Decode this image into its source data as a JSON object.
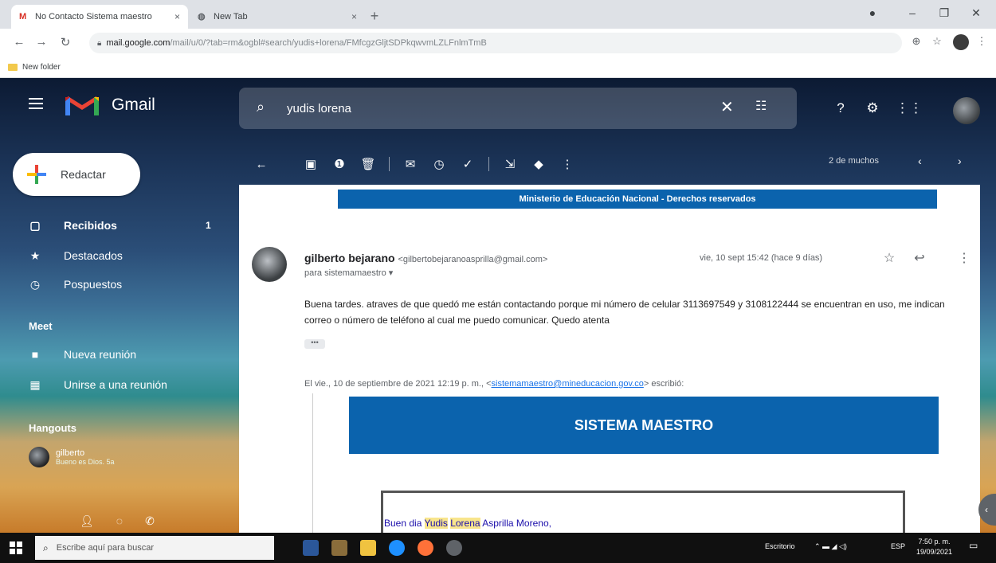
{
  "browser": {
    "tabs": [
      {
        "title": "No Contacto Sistema maestro",
        "close": "×"
      },
      {
        "title": "New Tab",
        "close": "×"
      }
    ],
    "new_tab": "+",
    "address": {
      "host": "mail.google.com",
      "path": "/mail/u/0/?tab=rm&ogbl#search/yudis+lorena/FMfcgzGljtSDPkqwvmLZLFnlmTmB"
    },
    "bookmark_folder": "New folder"
  },
  "gmail": {
    "product_name": "Gmail",
    "search": {
      "value": "yudis lorena"
    },
    "compose_label": "Redactar",
    "nav": [
      {
        "label": "Recibidos",
        "count": "1"
      },
      {
        "label": "Destacados"
      },
      {
        "label": "Pospuestos"
      }
    ],
    "meet": {
      "title": "Meet",
      "items": [
        {
          "label": "Nueva reunión"
        },
        {
          "label": "Unirse a una reunión"
        }
      ]
    },
    "hangouts": {
      "title": "Hangouts",
      "user": "gilberto",
      "status": "Bueno es Dios. 5a"
    },
    "pager": "2 de muchos",
    "message": {
      "banner_top": "Ministerio de Educación Nacional - Derechos reservados",
      "sender_name": "gilberto bejarano",
      "sender_email": "<gilbertobejaranoasprilla@gmail.com>",
      "recipient": "para sistemamaestro",
      "date": "vie, 10 sept 15:42 (hace 9 días)",
      "body": "Buena tardes. atraves de que quedó me están contactando porque mi número de celular 3113697549 y  3108122444 se encuentran en uso, me indican correo o número de teléfono al cual me puedo comunicar. Quedo atenta",
      "show_trimmed": "•••",
      "quote_prefix": "El vie., 10 de septiembre de 2021 12:19 p. m., <",
      "quote_email": "sistemamaestro@mineducacion.gov.co",
      "quote_suffix": "> escribió:",
      "banner_system": "SISTEMA MAESTRO",
      "greeting_pre": "Buen dia ",
      "greeting_hl1": "Yudis",
      "greeting_hl2": "Lorena",
      "greeting_post": " Asprilla Moreno,"
    }
  },
  "taskbar": {
    "search_placeholder": "Escribe aquí para buscar",
    "desktop": "Escritorio",
    "lang": "ESP",
    "time": "7:50 p. m.",
    "date": "19/09/2021"
  }
}
